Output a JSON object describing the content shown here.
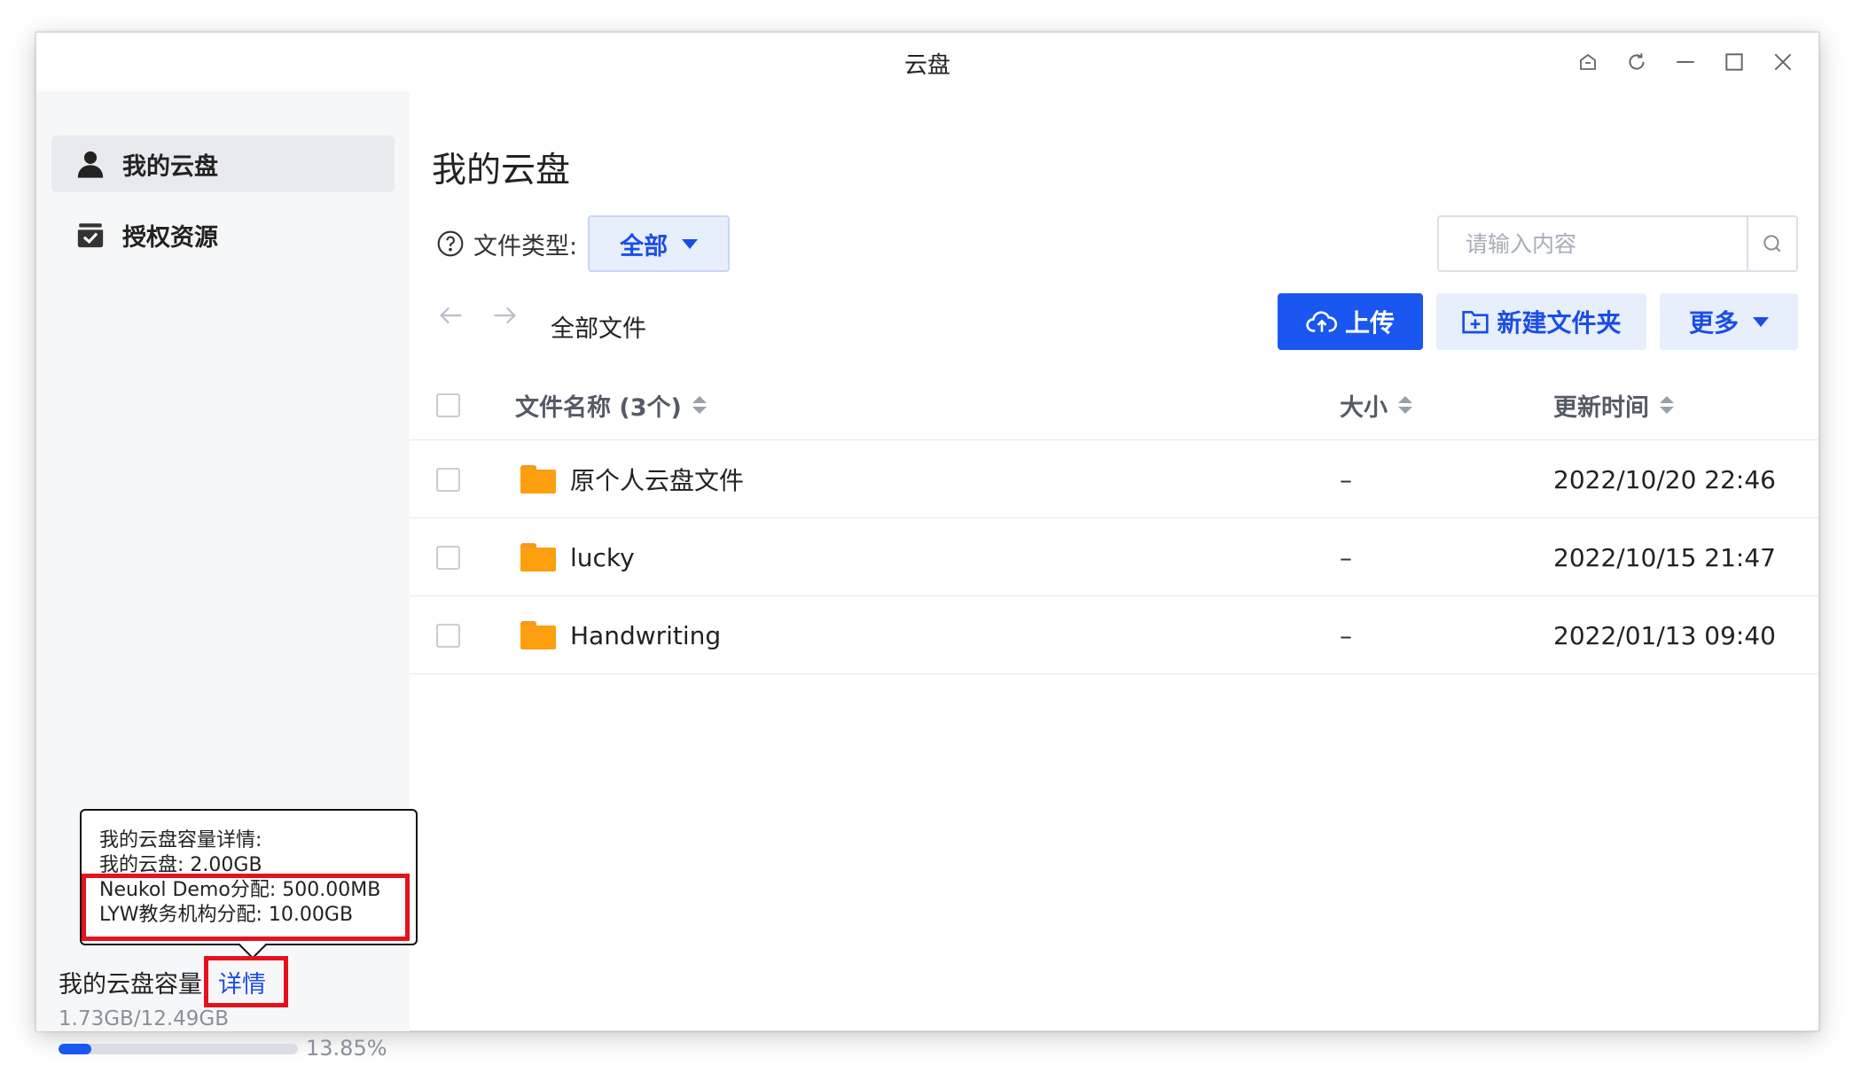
{
  "window": {
    "title": "云盘"
  },
  "sidebar": {
    "items": [
      {
        "label": "我的云盘",
        "icon": "user-icon",
        "active": true
      },
      {
        "label": "授权资源",
        "icon": "inbox-check-icon",
        "active": false
      }
    ]
  },
  "capacity_tooltip": {
    "heading": "我的云盘容量详情:",
    "lines": [
      "我的云盘: 2.00GB",
      "Neukol Demo分配: 500.00MB",
      "LYW教务机构分配: 10.00GB"
    ]
  },
  "capacity": {
    "label": "我的云盘容量",
    "detail_link": "详情",
    "used_total": "1.73GB/12.49GB",
    "percent_text": "13.85%",
    "percent_value": 13.85,
    "bar_color": "#1a56f0"
  },
  "main": {
    "title": "我的云盘",
    "filter_label": "文件类型:",
    "filter_value": "全部",
    "search_placeholder": "请输入内容",
    "breadcrumb": "全部文件",
    "buttons": {
      "upload": "上传",
      "new_folder": "新建文件夹",
      "more": "更多"
    }
  },
  "table": {
    "columns": {
      "name": "文件名称 (3个)",
      "size": "大小",
      "updated": "更新时间"
    },
    "rows": [
      {
        "name": "原个人云盘文件",
        "size": "–",
        "updated": "2022/10/20 22:46"
      },
      {
        "name": "lucky",
        "size": "–",
        "updated": "2022/10/15 21:47"
      },
      {
        "name": "Handwriting",
        "size": "–",
        "updated": "2022/01/13 09:40"
      }
    ]
  },
  "colors": {
    "accent": "#1a56f0",
    "folder": "#fd9f0f",
    "highlight": "#e5121c"
  }
}
